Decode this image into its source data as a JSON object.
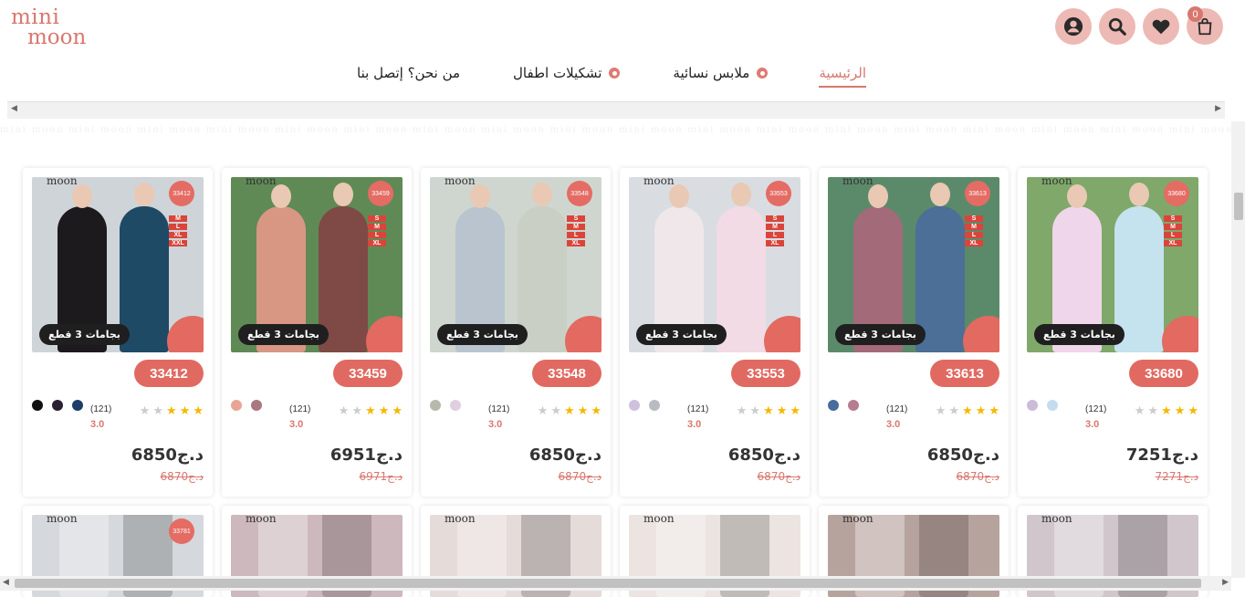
{
  "logo": {
    "line1": "mini",
    "line2": "moon"
  },
  "header": {
    "cart_count": "0"
  },
  "nav": [
    {
      "label": "الرئيسية",
      "active": true
    },
    {
      "label": "ملابس نسائية",
      "active": false
    },
    {
      "label": "تشكيلات اطفال",
      "active": false
    },
    {
      "label": "من نحن؟ إتصل بنا",
      "active": false
    }
  ],
  "pattern_text": "mini moon mini moon mini moon mini moon mini moon mini moon mini moon mini moon mini moon mini moon mini moon mini moon mini moon mini moon mini moon mini moon mini moon mini moon",
  "colors": {
    "accent": "#e06a62",
    "icon_bg": "#edb9b4",
    "star": "#f5b800"
  },
  "products": [
    {
      "code": "33680",
      "image_code": "33680",
      "pill": "بجامات 3 قطع",
      "rating_count": "(121)",
      "rating": "3.0",
      "stars": 3,
      "price": "7251د.ج",
      "old_price": "7271د.ج",
      "swatches": [
        "#cbbcd9",
        "#c5dcef"
      ],
      "bg": "#7fa86a",
      "figs": [
        "#f0d6ea",
        "#c5e2ef"
      ],
      "sizes": [
        "S",
        "M",
        "L",
        "XL"
      ]
    },
    {
      "code": "33613",
      "image_code": "33613",
      "pill": "بجامات 3 قطع",
      "rating_count": "(121)",
      "rating": "3.0",
      "stars": 3,
      "price": "6850د.ج",
      "old_price": "6870د.ج",
      "swatches": [
        "#466c9c",
        "#b57e8e"
      ],
      "bg": "#5b8a6a",
      "figs": [
        "#a36a7a",
        "#4b6f96"
      ],
      "sizes": [
        "S",
        "M",
        "L",
        "XL"
      ]
    },
    {
      "code": "33553",
      "image_code": "33553",
      "pill": "بجامات 3 قطع",
      "rating_count": "(121)",
      "rating": "3.0",
      "stars": 3,
      "price": "6850د.ج",
      "old_price": "6870د.ج",
      "swatches": [
        "#cfc1de",
        "#b8bcc2"
      ],
      "bg": "#d9dde2",
      "figs": [
        "#efe7e9",
        "#f2dbe4"
      ],
      "sizes": [
        "S",
        "M",
        "L",
        "XL"
      ]
    },
    {
      "code": "33548",
      "image_code": "33548",
      "pill": "بجامات 3 قطع",
      "rating_count": "(121)",
      "rating": "3.0",
      "stars": 3,
      "price": "6850د.ج",
      "old_price": "6870د.ج",
      "swatches": [
        "#b7b9ad",
        "#e0cfe0"
      ],
      "bg": "#cfd6d0",
      "figs": [
        "#b9c4ce",
        "#c9cfc5"
      ],
      "sizes": [
        "S",
        "M",
        "L",
        "XL"
      ]
    },
    {
      "code": "33459",
      "image_code": "33459",
      "pill": "بجامات 3 قطع",
      "rating_count": "(121)",
      "rating": "3.0",
      "stars": 3,
      "price": "6951د.ج",
      "old_price": "6971د.ج",
      "swatches": [
        "#e9a594",
        "#a97880"
      ],
      "bg": "#5f8a55",
      "figs": [
        "#d89783",
        "#7f4a45"
      ],
      "sizes": [
        "S",
        "M",
        "L",
        "XL"
      ]
    },
    {
      "code": "33412",
      "image_code": "33412",
      "pill": "بجامات 3 قطع",
      "rating_count": "(121)",
      "rating": "3.0",
      "stars": 3,
      "price": "6850د.ج",
      "old_price": "6870د.ج",
      "swatches": [
        "#111111",
        "#2a2030",
        "#1d3d6a"
      ],
      "bg": "#cfd4d8",
      "figs": [
        "#1c1a1c",
        "#1f4a66"
      ],
      "sizes": [
        "M",
        "L",
        "XL",
        "XXL"
      ]
    }
  ],
  "row2": [
    {
      "image_code": "33781",
      "bg": "#d5d8dc"
    },
    {
      "image_code": "",
      "bg": "#cdb8bd"
    },
    {
      "image_code": "",
      "bg": "#e5dbd8"
    },
    {
      "image_code": "",
      "bg": "#ece4e1"
    },
    {
      "image_code": "",
      "bg": "#b7a39e"
    },
    {
      "image_code": "",
      "bg": "#d1c6cc"
    }
  ]
}
